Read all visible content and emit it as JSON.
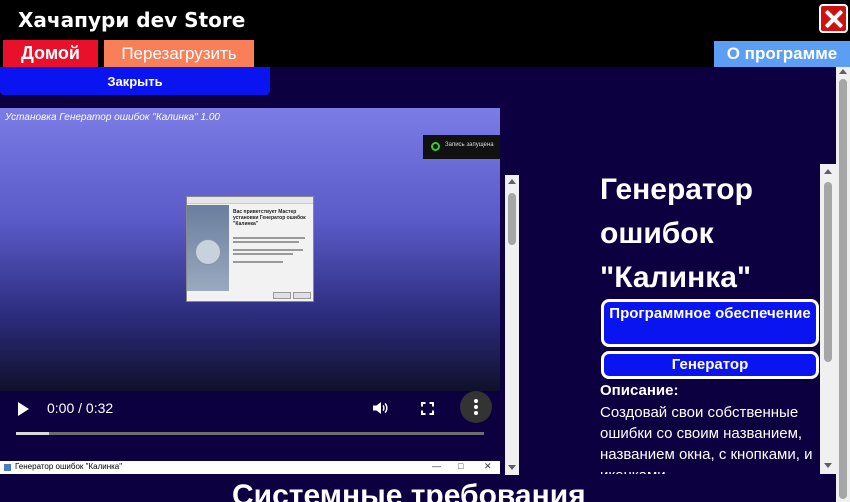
{
  "window": {
    "title": "Хачапури dev Store",
    "close_icon": "close-icon"
  },
  "nav": {
    "home_label": "Домой",
    "reload_label": "Перезагрузить",
    "about_label": "О программе",
    "colors": {
      "home": "#e8102a",
      "reload": "#f87f58",
      "about": "#5b9ef4"
    }
  },
  "panel": {
    "close_label": "Закрыть"
  },
  "video": {
    "caption": "Установка Генератор ошибок \"Калинка\" 1.00",
    "recording_label": "Запись запущена",
    "installer": {
      "title": "Вас приветствует Мастер установки Генератор ошибок \"Калинка\""
    },
    "time": "0:00 / 0:32",
    "progress": 0.07,
    "taskbar_title": "Генератор ошибок \"Калинка\""
  },
  "app": {
    "name": "Генератор ошибок \"Калинка\"",
    "tags": [
      "Программное обеспечение",
      "Генератор"
    ],
    "description_label": "Описание:",
    "description": "Создовай свои собственные ошибки со своим названием, названием окна, с кнопками, и иконками"
  },
  "section": {
    "system_requirements": "Системные требования"
  },
  "theme": {
    "background": "#0d0040",
    "tag_button": "#0a14f0"
  }
}
